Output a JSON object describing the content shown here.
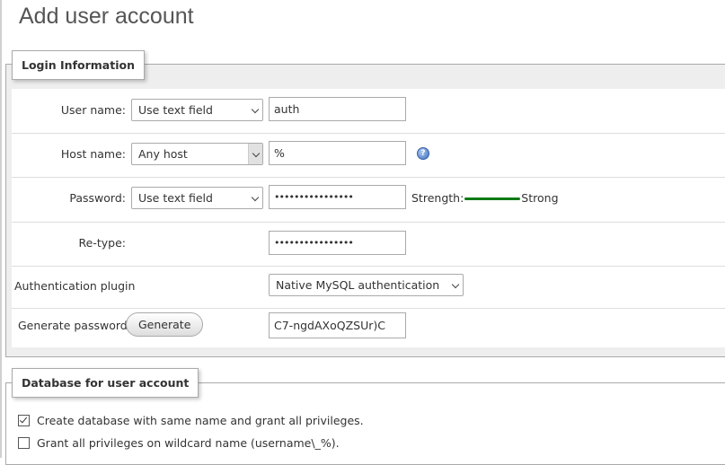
{
  "page": {
    "title": "Add user account"
  },
  "login": {
    "legend": "Login Information",
    "username": {
      "label": "User name:",
      "select": "Use text field",
      "value": "auth"
    },
    "hostname": {
      "label": "Host name:",
      "select": "Any host",
      "value": "%"
    },
    "password": {
      "label": "Password:",
      "select": "Use text field",
      "value": "••••••••••••••••",
      "strength_label": "Strength:",
      "strength_value": "Strong",
      "strength_color": "#0b7a14"
    },
    "retype": {
      "label": "Re-type:",
      "value": "••••••••••••••••"
    },
    "auth_plugin": {
      "label": "Authentication plugin",
      "select": "Native MySQL authentication"
    },
    "generate": {
      "label": "Generate password:",
      "button": "Generate",
      "value": "C7-ngdAXoQZSUr)C"
    }
  },
  "database": {
    "legend": "Database for user account",
    "options": [
      {
        "label": "Create database with same name and grant all privileges.",
        "checked": true
      },
      {
        "label": "Grant all privileges on wildcard name (username\\_%).",
        "checked": false
      }
    ]
  },
  "icons": {
    "help": "help-icon"
  }
}
